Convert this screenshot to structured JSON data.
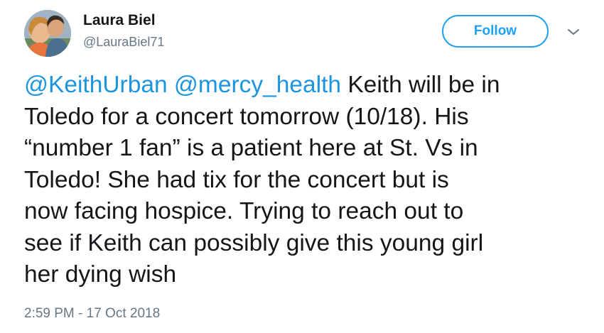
{
  "author": {
    "name": "Laura Biel",
    "handle": "@LauraBiel71"
  },
  "follow_button": {
    "label": "Follow"
  },
  "more_menu": {
    "icon": "chevron-down-icon"
  },
  "tweet": {
    "mention_1": "@KeithUrban",
    "mention_2": "@mercy_health",
    "text_line_1": " Keith will be in",
    "text_rest": "Toledo for a concert tomorrow (10/18). His\n“number 1 fan” is a patient here at St. Vs in\nToledo!  She had tix for the concert but is\nnow facing hospice. Trying to reach out to\nsee if Keith can possibly give this young girl\nher dying wish"
  },
  "timestamp": "2:59 PM - 17 Oct 2018",
  "colors": {
    "accent": "#1da1f2",
    "link": "#1b95e0",
    "text": "#14171a",
    "muted": "#657786"
  }
}
